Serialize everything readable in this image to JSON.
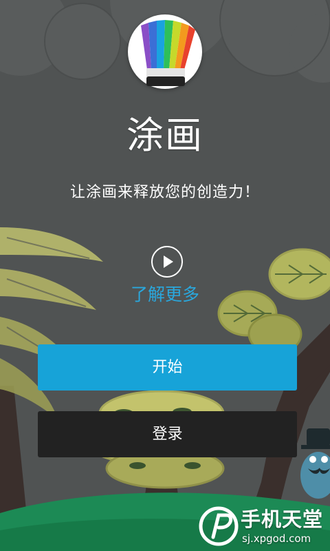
{
  "app": {
    "title": "涂画",
    "tagline": "让涂画来释放您的创造力！"
  },
  "intro": {
    "play_icon": "play-icon",
    "learn_more_label": "了解更多"
  },
  "actions": {
    "start_label": "开始",
    "login_label": "登录"
  },
  "watermark": {
    "text": "手机天堂",
    "url": "sj.xpgod.com"
  },
  "colors": {
    "background": "#4f5252",
    "accent": "#17a3d8",
    "link": "#2aa7dc",
    "secondary_button": "#222222",
    "grass": "#1c8a55"
  }
}
